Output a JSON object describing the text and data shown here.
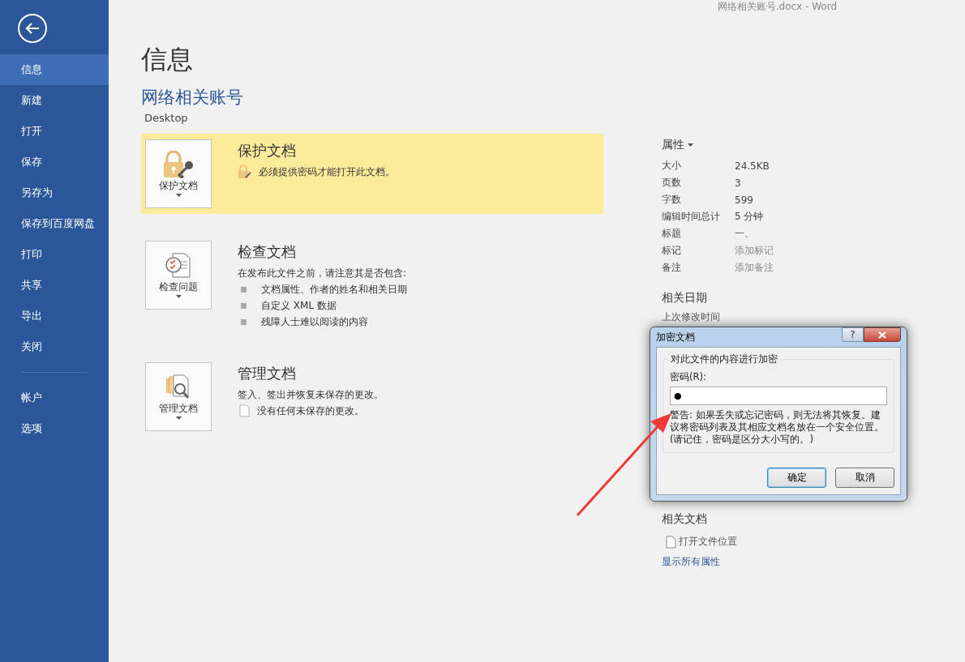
{
  "window": {
    "title": "网络相关账号.docx - Word"
  },
  "sidebar": {
    "items": [
      {
        "label": "信息",
        "selected": true
      },
      {
        "label": "新建",
        "selected": false
      },
      {
        "label": "打开",
        "selected": false
      },
      {
        "label": "保存",
        "selected": false
      },
      {
        "label": "另存为",
        "selected": false
      },
      {
        "label": "保存到百度网盘",
        "selected": false
      },
      {
        "label": "打印",
        "selected": false
      },
      {
        "label": "共享",
        "selected": false
      },
      {
        "label": "导出",
        "selected": false
      },
      {
        "label": "关闭",
        "selected": false
      }
    ],
    "bottom_items": [
      {
        "label": "帐户",
        "selected": false
      },
      {
        "label": "选项",
        "selected": false
      }
    ]
  },
  "page": {
    "heading": "信息",
    "doc_name": "网络相关账号",
    "location": "Desktop"
  },
  "sections": [
    {
      "kind": "protect",
      "button": "保护文档",
      "title": "保护文档",
      "highlighted": true,
      "lines": [
        {
          "kind": "lock",
          "text": "必须提供密码才能打开此文档。"
        }
      ]
    },
    {
      "kind": "inspect",
      "button": "检查问题",
      "title": "检查文档",
      "highlighted": false,
      "lines": [
        {
          "kind": "text",
          "text": "在发布此文件之前，请注意其是否包含:"
        },
        {
          "kind": "bullet",
          "text": "文档属性、作者的姓名和相关日期"
        },
        {
          "kind": "bullet",
          "text": "自定义 XML 数据"
        },
        {
          "kind": "bullet",
          "text": "残障人士难以阅读的内容"
        }
      ]
    },
    {
      "kind": "manage",
      "button": "管理文档",
      "title": "管理文档",
      "highlighted": false,
      "lines": [
        {
          "kind": "text",
          "text": "签入、签出并恢复未保存的更改。"
        },
        {
          "kind": "file",
          "text": "没有任何未保存的更改。"
        }
      ]
    }
  ],
  "properties": {
    "heading": "属性",
    "rows": [
      {
        "label": "大小",
        "value": "24.5KB",
        "kind": "value"
      },
      {
        "label": "页数",
        "value": "3",
        "kind": "value"
      },
      {
        "label": "字数",
        "value": "599",
        "kind": "value"
      },
      {
        "label": "编辑时间总计",
        "value": "5 分钟",
        "kind": "value"
      },
      {
        "label": "标题",
        "value": "一、",
        "kind": "value"
      },
      {
        "label": "标记",
        "placeholder": "添加标记",
        "kind": "placeholder"
      },
      {
        "label": "备注",
        "placeholder": "添加备注",
        "kind": "placeholder"
      }
    ]
  },
  "related_dates": {
    "heading": "相关日期",
    "items": [
      "上次修改时间"
    ]
  },
  "related_docs": {
    "heading": "相关文档",
    "items": [
      "打开文件位置"
    ],
    "link": "显示所有属性"
  },
  "dialog": {
    "title": "加密文档",
    "help": "?",
    "group": "对此文件的内容进行加密",
    "field_label": "密码(R):",
    "value": "●",
    "warning": "警告: 如果丢失或忘记密码，则无法将其恢复。建议将密码列表及其相应文档名放在一个安全位置。(请记住，密码是区分大小写的。)",
    "buttons": [
      {
        "label": "确定",
        "selected": true
      },
      {
        "label": "取消",
        "selected": false
      }
    ]
  }
}
